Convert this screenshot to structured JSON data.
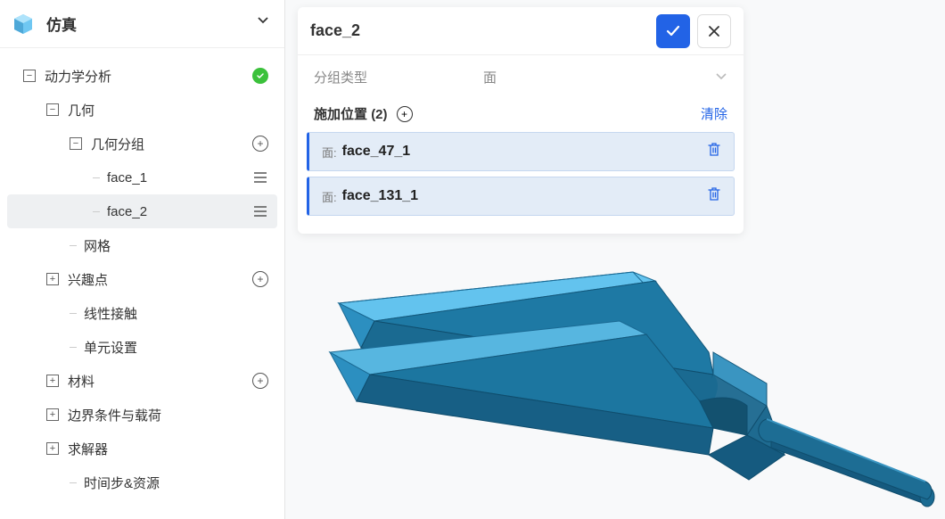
{
  "sidebar": {
    "title": "仿真"
  },
  "tree": {
    "root": "动力学分析",
    "geom": "几何",
    "geom_group": "几何分组",
    "face_1": "face_1",
    "face_2": "face_2",
    "mesh": "网格",
    "poi": "兴趣点",
    "linear_contact": "线性接触",
    "unit_settings": "单元设置",
    "material": "材料",
    "bc_load": "边界条件与载荷",
    "solver": "求解器",
    "timestep": "时间步&资源"
  },
  "panel": {
    "title": "face_2",
    "group_type_label": "分组类型",
    "group_type_value": "面",
    "list_title_prefix": "施加位置",
    "list_count": "(2)",
    "clear_label": "清除",
    "item_prefix": "面:",
    "items": [
      {
        "name": "face_47_1"
      },
      {
        "name": "face_131_1"
      }
    ]
  }
}
